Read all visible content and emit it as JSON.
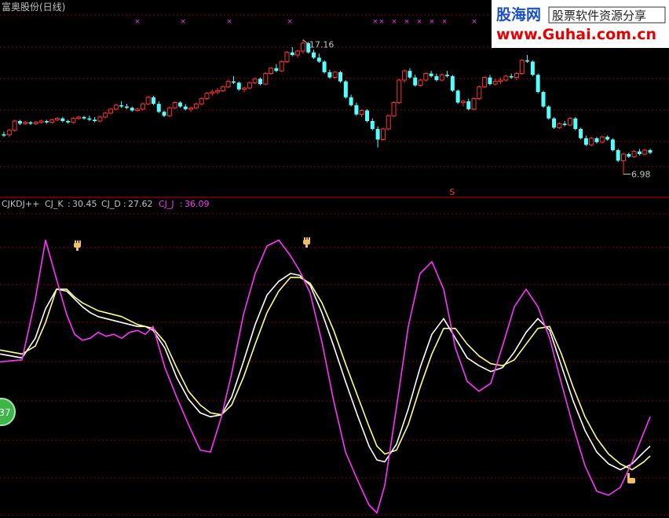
{
  "title": "富奥股份(日线)",
  "watermark": {
    "brand": "股海网",
    "slogan": "股票软件资源分享",
    "url": "www.Guhai.com.cn"
  },
  "badge_text": "37",
  "colors": {
    "up": "#ff3232",
    "down": "#54ffff",
    "k_line": "#ffffff",
    "d_line": "#ffff80",
    "j_line": "#ff32ff",
    "grid": "#8b0000",
    "text": "#c0c0c0"
  },
  "chart_data": [
    {
      "type": "candlestick",
      "title": "富奥股份(日线)",
      "high_label": "17.16",
      "low_label": "6.98",
      "signal_label": "S",
      "signal_index": 84,
      "ylim": [
        6.0,
        18.5
      ],
      "ohlc": [
        [
          10.0,
          10.2,
          9.8,
          9.9
        ],
        [
          9.95,
          10.4,
          9.8,
          10.3
        ],
        [
          10.3,
          11.1,
          10.2,
          11.0
        ],
        [
          11.0,
          11.1,
          10.7,
          10.8
        ],
        [
          10.8,
          11.0,
          10.7,
          10.9
        ],
        [
          10.9,
          11.0,
          10.7,
          10.8
        ],
        [
          10.8,
          11.0,
          10.7,
          10.9
        ],
        [
          10.9,
          11.1,
          10.8,
          11.0
        ],
        [
          11.0,
          11.1,
          10.8,
          10.9
        ],
        [
          10.9,
          11.2,
          10.8,
          11.1
        ],
        [
          11.1,
          11.3,
          11.0,
          11.2
        ],
        [
          11.2,
          11.3,
          10.9,
          11.0
        ],
        [
          11.0,
          11.1,
          10.8,
          10.9
        ],
        [
          10.9,
          11.3,
          10.8,
          11.2
        ],
        [
          11.2,
          11.4,
          11.1,
          11.3
        ],
        [
          11.3,
          11.4,
          11.1,
          11.2
        ],
        [
          11.2,
          11.4,
          11.0,
          11.1
        ],
        [
          11.1,
          11.3,
          10.9,
          11.0
        ],
        [
          11.0,
          11.4,
          10.9,
          11.3
        ],
        [
          11.3,
          11.7,
          11.2,
          11.6
        ],
        [
          11.6,
          12.0,
          11.5,
          11.9
        ],
        [
          11.9,
          12.3,
          11.8,
          12.2
        ],
        [
          12.2,
          12.5,
          12.0,
          12.1
        ],
        [
          12.1,
          12.3,
          11.9,
          12.0
        ],
        [
          12.0,
          12.1,
          11.7,
          11.8
        ],
        [
          11.8,
          12.0,
          11.7,
          11.9
        ],
        [
          11.9,
          12.4,
          11.8,
          12.3
        ],
        [
          12.3,
          12.9,
          12.2,
          12.8
        ],
        [
          12.8,
          12.9,
          12.2,
          12.3
        ],
        [
          12.3,
          12.5,
          11.6,
          11.7
        ],
        [
          11.7,
          11.8,
          11.3,
          11.4
        ],
        [
          11.4,
          12.1,
          11.3,
          12.0
        ],
        [
          12.0,
          12.5,
          11.9,
          12.4
        ],
        [
          12.4,
          12.5,
          12.0,
          12.1
        ],
        [
          12.1,
          12.3,
          11.8,
          11.9
        ],
        [
          11.9,
          12.1,
          11.7,
          12.0
        ],
        [
          12.0,
          12.4,
          11.9,
          12.3
        ],
        [
          12.3,
          12.8,
          12.2,
          12.7
        ],
        [
          12.7,
          13.2,
          12.6,
          13.1
        ],
        [
          13.1,
          13.4,
          12.9,
          13.2
        ],
        [
          13.2,
          13.5,
          13.0,
          13.3
        ],
        [
          13.3,
          13.7,
          13.2,
          13.6
        ],
        [
          13.6,
          14.1,
          13.5,
          14.0
        ],
        [
          14.0,
          14.4,
          13.8,
          13.9
        ],
        [
          13.9,
          14.0,
          13.3,
          13.4
        ],
        [
          13.4,
          13.6,
          13.2,
          13.5
        ],
        [
          13.5,
          14.0,
          13.4,
          13.9
        ],
        [
          13.9,
          14.3,
          13.8,
          14.2
        ],
        [
          14.2,
          14.3,
          13.7,
          13.8
        ],
        [
          13.8,
          14.7,
          13.7,
          14.6
        ],
        [
          14.6,
          15.1,
          14.5,
          15.0
        ],
        [
          15.0,
          15.3,
          14.7,
          14.8
        ],
        [
          14.8,
          15.6,
          14.7,
          15.5
        ],
        [
          15.5,
          16.3,
          15.4,
          16.2
        ],
        [
          16.2,
          16.6,
          15.9,
          16.0
        ],
        [
          16.0,
          16.4,
          15.8,
          16.3
        ],
        [
          16.3,
          17.16,
          16.1,
          16.9
        ],
        [
          16.9,
          17.0,
          16.1,
          16.2
        ],
        [
          16.2,
          16.4,
          15.7,
          15.8
        ],
        [
          15.8,
          16.1,
          15.4,
          15.5
        ],
        [
          15.5,
          15.6,
          14.6,
          14.7
        ],
        [
          14.7,
          14.9,
          14.2,
          14.3
        ],
        [
          14.3,
          14.8,
          14.2,
          14.7
        ],
        [
          14.7,
          14.8,
          13.9,
          14.0
        ],
        [
          14.0,
          14.1,
          12.7,
          12.8
        ],
        [
          12.8,
          13.0,
          12.1,
          12.2
        ],
        [
          12.2,
          12.4,
          11.4,
          11.5
        ],
        [
          11.5,
          11.9,
          11.3,
          11.8
        ],
        [
          11.8,
          11.9,
          10.9,
          11.0
        ],
        [
          11.0,
          11.2,
          10.3,
          10.4
        ],
        [
          10.4,
          10.6,
          9.0,
          9.6
        ],
        [
          9.6,
          10.5,
          9.5,
          10.4
        ],
        [
          10.4,
          11.5,
          10.3,
          11.4
        ],
        [
          11.4,
          12.5,
          11.3,
          12.4
        ],
        [
          12.4,
          14.2,
          12.3,
          14.1
        ],
        [
          14.1,
          14.9,
          13.9,
          14.8
        ],
        [
          14.8,
          15.0,
          14.2,
          14.3
        ],
        [
          14.3,
          14.5,
          13.6,
          13.7
        ],
        [
          13.7,
          14.2,
          13.6,
          14.1
        ],
        [
          14.1,
          14.7,
          14.0,
          14.6
        ],
        [
          14.6,
          14.8,
          14.3,
          14.4
        ],
        [
          14.4,
          14.6,
          14.0,
          14.1
        ],
        [
          14.1,
          14.6,
          14.0,
          14.5
        ],
        [
          14.5,
          14.8,
          14.3,
          14.4
        ],
        [
          14.4,
          14.5,
          13.2,
          13.3
        ],
        [
          13.3,
          13.4,
          12.3,
          12.4
        ],
        [
          12.4,
          12.6,
          12.1,
          12.5
        ],
        [
          12.5,
          12.7,
          11.8,
          11.9
        ],
        [
          11.9,
          12.8,
          11.8,
          12.7
        ],
        [
          12.7,
          13.7,
          12.6,
          13.6
        ],
        [
          13.6,
          14.4,
          13.5,
          14.3
        ],
        [
          14.3,
          14.5,
          13.7,
          13.8
        ],
        [
          13.8,
          14.2,
          13.7,
          14.0
        ],
        [
          14.0,
          14.3,
          13.8,
          14.1
        ],
        [
          14.1,
          14.5,
          14.0,
          14.4
        ],
        [
          14.4,
          14.6,
          14.2,
          14.3
        ],
        [
          14.3,
          14.7,
          14.1,
          14.6
        ],
        [
          14.6,
          15.7,
          14.5,
          15.6
        ],
        [
          15.6,
          16.0,
          15.4,
          15.5
        ],
        [
          15.5,
          15.6,
          14.4,
          14.5
        ],
        [
          14.5,
          14.6,
          13.1,
          13.2
        ],
        [
          13.2,
          13.3,
          12.0,
          12.1
        ],
        [
          12.1,
          12.2,
          11.1,
          11.2
        ],
        [
          11.2,
          11.3,
          10.4,
          10.5
        ],
        [
          10.5,
          10.9,
          10.4,
          10.8
        ],
        [
          10.8,
          11.0,
          10.6,
          10.7
        ],
        [
          10.7,
          11.3,
          10.6,
          11.2
        ],
        [
          11.2,
          11.3,
          10.3,
          10.4
        ],
        [
          10.4,
          10.5,
          9.6,
          9.7
        ],
        [
          9.7,
          9.9,
          9.1,
          9.2
        ],
        [
          9.2,
          9.8,
          9.1,
          9.7
        ],
        [
          9.7,
          9.8,
          9.3,
          9.4
        ],
        [
          9.4,
          9.9,
          9.3,
          9.8
        ],
        [
          9.8,
          9.9,
          9.5,
          9.6
        ],
        [
          9.6,
          9.7,
          8.7,
          8.8
        ],
        [
          8.8,
          8.9,
          7.9,
          8.0
        ],
        [
          8.0,
          8.6,
          6.98,
          8.5
        ],
        [
          8.5,
          8.6,
          8.2,
          8.3
        ],
        [
          8.3,
          8.8,
          8.2,
          8.7
        ],
        [
          8.7,
          8.9,
          8.4,
          8.5
        ],
        [
          8.5,
          8.9,
          8.4,
          8.8
        ],
        [
          8.8,
          8.9,
          8.5,
          8.6
        ]
      ]
    },
    {
      "type": "line",
      "title": "CJKDJ++",
      "legend": [
        {
          "name": "CJ_K",
          "value": "30.45"
        },
        {
          "name": "CJ_D",
          "value": "27.62"
        },
        {
          "name": "CJ_J",
          "value": "36.09"
        }
      ],
      "ylim": [
        -20,
        135
      ],
      "x": [
        0,
        28,
        45,
        58,
        72,
        85,
        95,
        105,
        115,
        125,
        135,
        145,
        155,
        165,
        175,
        185,
        195,
        210,
        225,
        240,
        255,
        268,
        282,
        295,
        310,
        325,
        340,
        355,
        370,
        382,
        395,
        410,
        425,
        440,
        455,
        470,
        480,
        490,
        505,
        520,
        535,
        550,
        565,
        580,
        595,
        610,
        625,
        640,
        655,
        670,
        685,
        700,
        715,
        730,
        745,
        760,
        775,
        790,
        805,
        820,
        828
      ],
      "series": [
        {
          "name": "CJ_K",
          "values": [
            62,
            60,
            70,
            85,
            95,
            94,
            90,
            86,
            83,
            81,
            80,
            79,
            78,
            77,
            76,
            76,
            74,
            65,
            50,
            39,
            32,
            30,
            31,
            40,
            58,
            77,
            92,
            99,
            103,
            102,
            97,
            83,
            66,
            48,
            31,
            15,
            8,
            7,
            16,
            34,
            55,
            72,
            80,
            70,
            60,
            56,
            53,
            55,
            63,
            73,
            80,
            74,
            56,
            38,
            23,
            12,
            6,
            3,
            6,
            12,
            15
          ]
        },
        {
          "name": "CJ_D",
          "values": [
            64,
            62,
            66,
            78,
            95,
            95,
            91,
            88,
            86,
            84,
            83,
            82,
            81,
            79,
            77,
            76,
            75,
            68,
            55,
            43,
            36,
            32,
            31,
            36,
            50,
            67,
            83,
            94,
            101,
            101,
            98,
            88,
            74,
            57,
            41,
            25,
            15,
            11,
            13,
            26,
            45,
            62,
            75,
            75,
            67,
            61,
            57,
            56,
            59,
            67,
            75,
            76,
            62,
            45,
            30,
            19,
            11,
            6,
            3,
            7,
            10
          ]
        },
        {
          "name": "CJ_J",
          "values": [
            58,
            59,
            90,
            120,
            100,
            82,
            72,
            69,
            70,
            73,
            71,
            72,
            70,
            73,
            74,
            72,
            76,
            55,
            40,
            26,
            13,
            12,
            30,
            52,
            82,
            103,
            117,
            120,
            112,
            104,
            93,
            68,
            38,
            12,
            -2,
            -15,
            -19,
            -5,
            35,
            76,
            103,
            109,
            95,
            65,
            48,
            43,
            47,
            66,
            86,
            95,
            86,
            70,
            47,
            25,
            5,
            -8,
            -10,
            -6,
            7,
            22,
            30
          ]
        }
      ]
    }
  ]
}
